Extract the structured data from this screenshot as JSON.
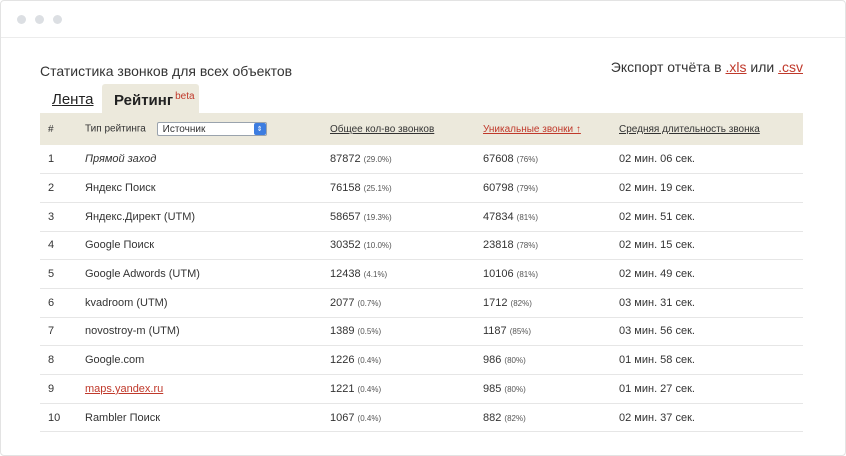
{
  "window": {
    "controls": [
      "close",
      "minimize",
      "maximize"
    ]
  },
  "page_title": "Статистика звонков для всех объектов",
  "export": {
    "prefix": "Экспорт отчёта в",
    "xls": ".xls",
    "or": "или",
    "csv": ".csv"
  },
  "tabs": {
    "feed": "Лента",
    "rating": "Рейтинг",
    "rating_badge": "beta"
  },
  "table": {
    "headers": {
      "num": "#",
      "type_label": "Тип рейтинга",
      "type_select": "Источник",
      "total": "Общее кол-во звонков",
      "unique": "Уникальные звонки ↑",
      "avg": "Средняя длительность звонка"
    },
    "rows": [
      {
        "n": "1",
        "source": "Прямой заход",
        "total": "87872",
        "total_pct": "(29.0%)",
        "unique": "67608",
        "unique_pct": "(76%)",
        "avg": "02 мин. 06 сек."
      },
      {
        "n": "2",
        "source": "Яндекс Поиск",
        "total": "76158",
        "total_pct": "(25.1%)",
        "unique": "60798",
        "unique_pct": "(79%)",
        "avg": "02 мин. 19 сек."
      },
      {
        "n": "3",
        "source": "Яндекс.Директ (UTM)",
        "total": "58657",
        "total_pct": "(19.3%)",
        "unique": "47834",
        "unique_pct": "(81%)",
        "avg": "02 мин. 51 сек."
      },
      {
        "n": "4",
        "source": "Google Поиск",
        "total": "30352",
        "total_pct": "(10.0%)",
        "unique": "23818",
        "unique_pct": "(78%)",
        "avg": "02 мин. 15 сек."
      },
      {
        "n": "5",
        "source": "Google Adwords (UTM)",
        "total": "12438",
        "total_pct": "(4.1%)",
        "unique": "10106",
        "unique_pct": "(81%)",
        "avg": "02 мин. 49 сек."
      },
      {
        "n": "6",
        "source": "kvadroom (UTM)",
        "total": "2077",
        "total_pct": "(0.7%)",
        "unique": "1712",
        "unique_pct": "(82%)",
        "avg": "03 мин. 31 сек."
      },
      {
        "n": "7",
        "source": "novostroy-m (UTM)",
        "total": "1389",
        "total_pct": "(0.5%)",
        "unique": "1187",
        "unique_pct": "(85%)",
        "avg": "03 мин. 56 сек."
      },
      {
        "n": "8",
        "source": "Google.com",
        "total": "1226",
        "total_pct": "(0.4%)",
        "unique": "986",
        "unique_pct": "(80%)",
        "avg": "01 мин. 58 сек."
      },
      {
        "n": "9",
        "source": "maps.yandex.ru",
        "total": "1221",
        "total_pct": "(0.4%)",
        "unique": "985",
        "unique_pct": "(80%)",
        "avg": "01 мин. 27 сек."
      },
      {
        "n": "10",
        "source": "Rambler Поиск",
        "total": "1067",
        "total_pct": "(0.4%)",
        "unique": "882",
        "unique_pct": "(82%)",
        "avg": "02 мин. 37 сек."
      }
    ]
  },
  "colors": {
    "accent": "#c0392b",
    "header_bg": "#ece9dc",
    "select_arrow": "#3d7de0"
  }
}
